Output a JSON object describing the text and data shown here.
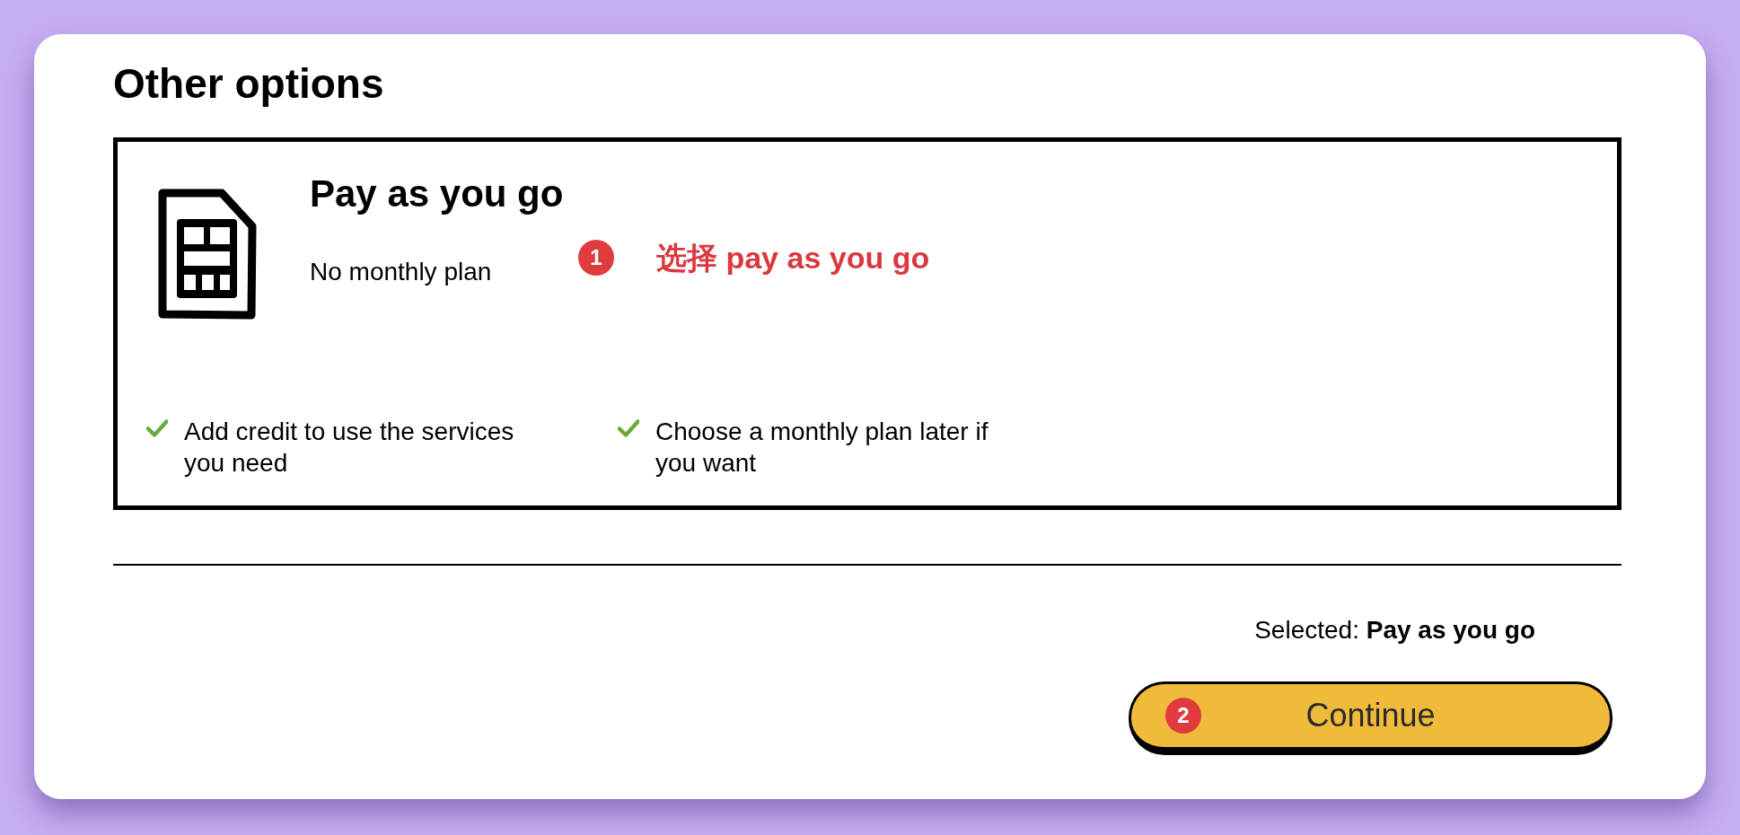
{
  "heading": "Other options",
  "options": [
    {
      "title": "Pay as you go",
      "subtitle": "No monthly plan",
      "selected": true,
      "annotation": {
        "marker": "1",
        "note": "选择 pay as you go"
      },
      "features": [
        "Add credit to use the services you need",
        "Choose a monthly plan later if you want"
      ]
    }
  ],
  "summary": "Selected: **Pay as you go**",
  "continue_button": {
    "label": "Continue",
    "marker": "2"
  }
}
